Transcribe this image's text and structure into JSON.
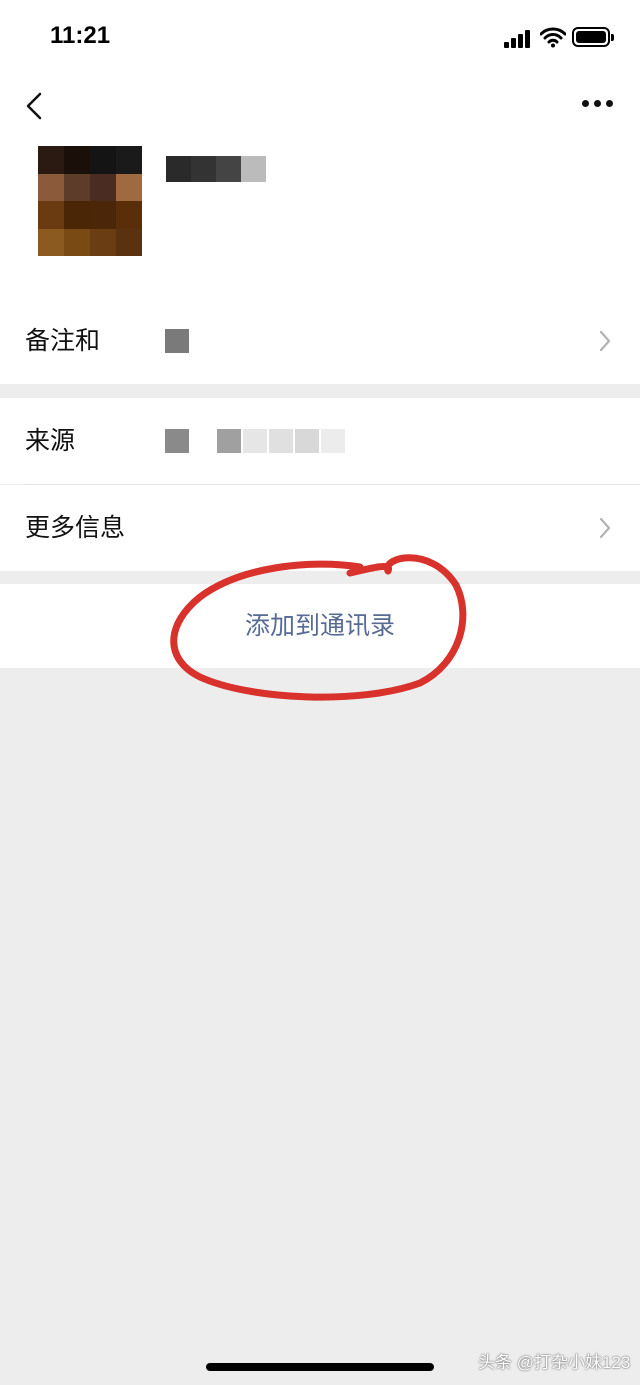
{
  "status_bar": {
    "time": "11:21"
  },
  "profile": {
    "avatar_pixels": [
      "#2a1a12",
      "#1b0f0a",
      "#141414",
      "#1a1a1a",
      "#8a5a3a",
      "#5e3c2a",
      "#4a2c20",
      "#a06a40",
      "#6a3a10",
      "#4a2506",
      "#4c2608",
      "#5a2e08",
      "#8a5a20",
      "#7a4a14",
      "#6a3d12",
      "#5a3210"
    ],
    "nickname_pixels": [
      "#2a2a2a",
      "#333333",
      "#444444",
      "#bbbbbb"
    ]
  },
  "rows": [
    {
      "label": "备注和",
      "value_pixels": [
        "#7a7a7a"
      ],
      "has_chevron": true
    },
    {
      "label": "来源",
      "value_pixels": [
        "#8a8a8a",
        "#ffffff",
        "#a0a0a0",
        "#e6e6e6",
        "#e0e0e0",
        "#d8d8d8",
        "#ececec"
      ],
      "has_chevron": false
    },
    {
      "label": "更多信息",
      "value_pixels": [],
      "has_chevron": true
    }
  ],
  "actions": {
    "add_to_contacts": "添加到通讯录"
  },
  "annotation": {
    "color": "#d9312b"
  },
  "watermark": "头条 @打杂小妹123",
  "colors": {
    "link": "#576b95",
    "page_bg": "#ededed"
  }
}
